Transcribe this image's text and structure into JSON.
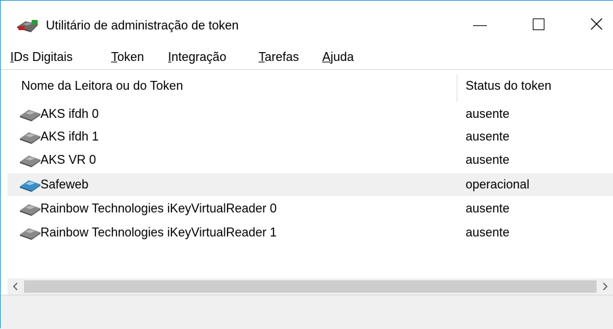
{
  "window": {
    "title": "Utilitário de administração de token",
    "icon": "token-key-icon",
    "controls": {
      "minimize": "minimize-icon",
      "maximize": "maximize-icon",
      "close": "close-icon"
    }
  },
  "menu": [
    {
      "mnemonic": "I",
      "rest": "Ds Digitais"
    },
    {
      "mnemonic": "T",
      "rest": "oken"
    },
    {
      "mnemonic": "I",
      "rest": "ntegração"
    },
    {
      "mnemonic": "T",
      "rest": "arefas"
    },
    {
      "mnemonic": "A",
      "rest": "juda"
    }
  ],
  "list": {
    "columns": {
      "name": "Nome da Leitora ou do Token",
      "status": "Status do token"
    },
    "rows": [
      {
        "name": "AKS ifdh 0",
        "status": "ausente",
        "icon": "card-reader-gray-icon"
      },
      {
        "name": "AKS ifdh 1",
        "status": "ausente",
        "icon": "card-reader-gray-icon"
      },
      {
        "name": "AKS VR 0",
        "status": "ausente",
        "icon": "card-reader-gray-icon"
      },
      {
        "name": "Safeweb",
        "status": "operacional",
        "icon": "card-reader-blue-icon"
      },
      {
        "name": "Rainbow Technologies iKeyVirtualReader 0",
        "status": "ausente",
        "icon": "card-reader-gray-icon"
      },
      {
        "name": "Rainbow Technologies iKeyVirtualReader 1",
        "status": "ausente",
        "icon": "card-reader-gray-icon"
      }
    ],
    "selected_row": "Safeweb"
  },
  "colors": {
    "window_border": "#2a9bd6",
    "selected_row": "#f0f0f0",
    "scrollbar_track": "#f0f0f0",
    "scrollbar_thumb": "#cdcdcd",
    "reader_gray": "#8a8a8a",
    "reader_blue": "#3a8fc4"
  }
}
